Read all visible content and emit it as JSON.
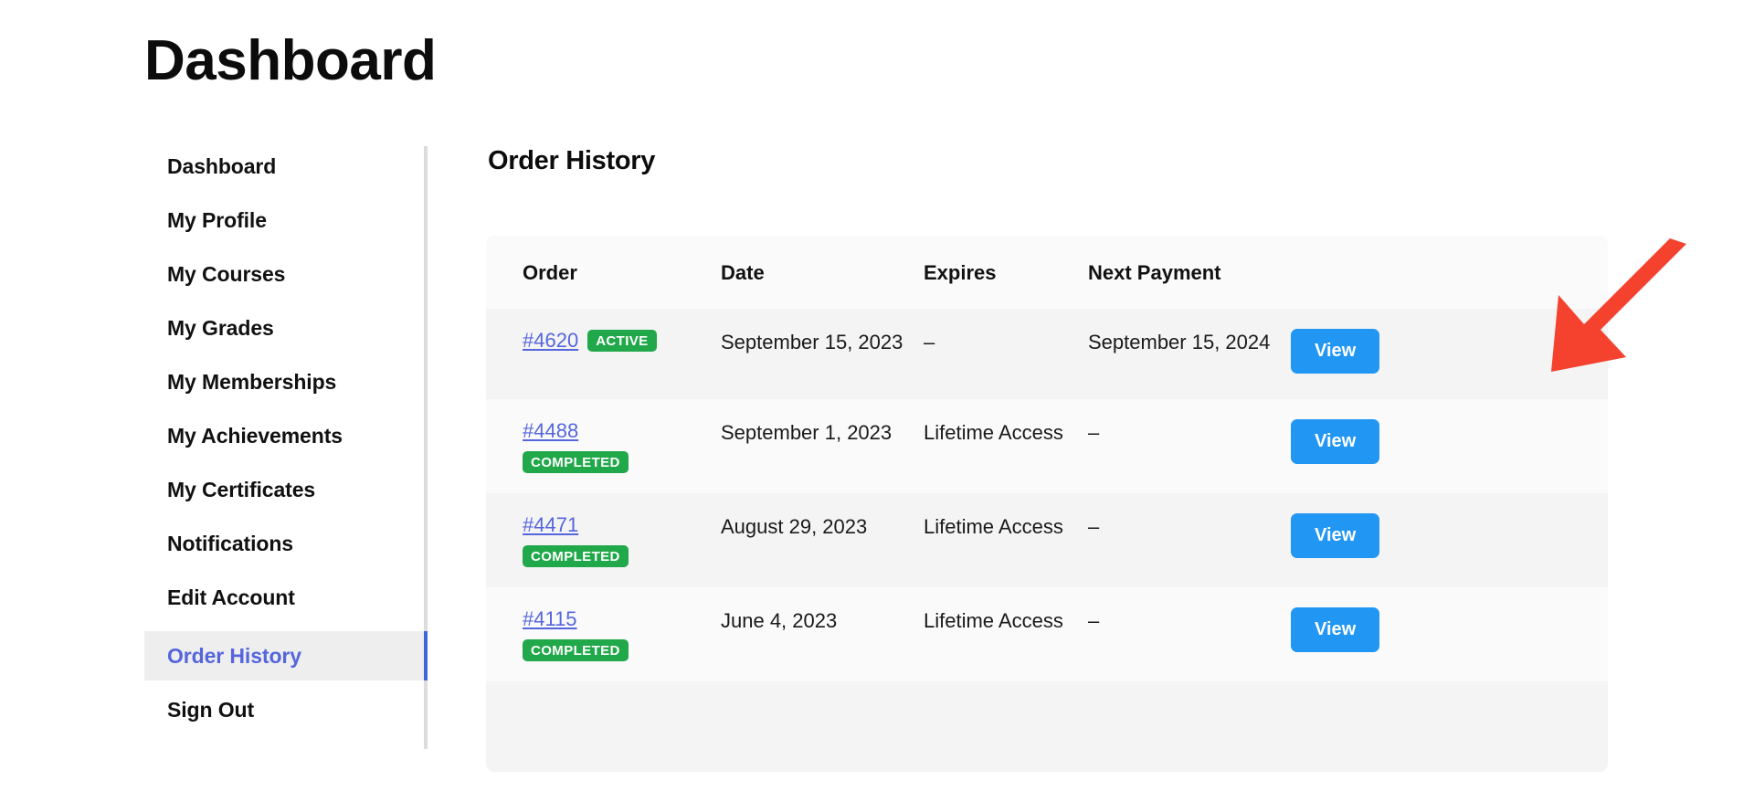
{
  "page": {
    "title": "Dashboard"
  },
  "sidebar": {
    "items": [
      {
        "label": "Dashboard",
        "active": false
      },
      {
        "label": "My Profile",
        "active": false
      },
      {
        "label": "My Courses",
        "active": false
      },
      {
        "label": "My Grades",
        "active": false
      },
      {
        "label": "My Memberships",
        "active": false
      },
      {
        "label": "My Achievements",
        "active": false
      },
      {
        "label": "My Certificates",
        "active": false
      },
      {
        "label": "Notifications",
        "active": false
      },
      {
        "label": "Edit Account",
        "active": false
      },
      {
        "label": "Order History",
        "active": true
      },
      {
        "label": "Sign Out",
        "active": false
      }
    ]
  },
  "main": {
    "section_title": "Order History",
    "table": {
      "columns": [
        "Order",
        "Date",
        "Expires",
        "Next Payment",
        ""
      ],
      "action_label": "View",
      "rows": [
        {
          "order": "#4620",
          "badge": "ACTIVE",
          "date": "September 15, 2023",
          "expires": "–",
          "next_payment": "September 15, 2024",
          "action": "View"
        },
        {
          "order": "#4488",
          "badge": "COMPLETED",
          "date": "September 1, 2023",
          "expires": "Lifetime Access",
          "next_payment": "–",
          "action": "View"
        },
        {
          "order": "#4471",
          "badge": "COMPLETED",
          "date": "August 29, 2023",
          "expires": "Lifetime Access",
          "next_payment": "–",
          "action": "View"
        },
        {
          "order": "#4115",
          "badge": "COMPLETED",
          "date": "June 4, 2023",
          "expires": "Lifetime Access",
          "next_payment": "–",
          "action": "View"
        }
      ]
    }
  },
  "annotation": {
    "type": "arrow",
    "color": "#f4422f",
    "points_to": "View"
  },
  "colors": {
    "accent_blue": "#4067d8",
    "link": "#5566dd",
    "badge_green": "#21a84a",
    "button_blue": "#2196f3",
    "arrow_red": "#f4422f",
    "row_stripe": "#f4f4f4",
    "card_bg": "#fafafa",
    "active_nav_bg": "#eeeeee"
  }
}
